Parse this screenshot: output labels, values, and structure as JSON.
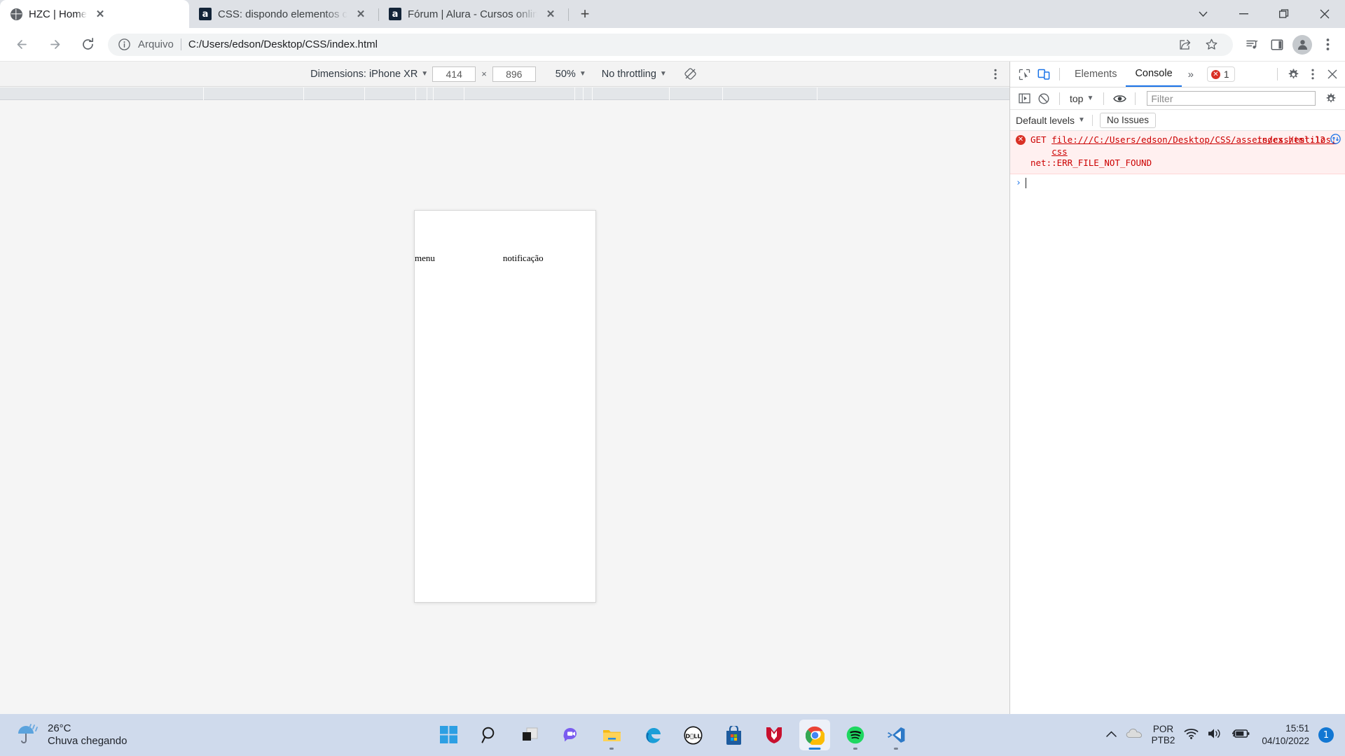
{
  "browser": {
    "tabs": [
      {
        "title": "HZC | Home",
        "favicon": "globe-icon",
        "active": true
      },
      {
        "title": "CSS: dispondo elementos com Fl",
        "favicon": "alura-icon",
        "active": false
      },
      {
        "title": "Fórum | Alura - Cursos online de",
        "favicon": "alura-icon",
        "active": false
      }
    ],
    "new_tab_label": "+",
    "close_label": "✕",
    "window_controls": [
      "tab-search-icon",
      "minimize-icon",
      "maximize-icon",
      "close-icon"
    ],
    "omnibox": {
      "scheme_label": "Arquivo",
      "url": "C:/Users/edson/Desktop/CSS/index.html",
      "info_icon": "info-circle-icon"
    },
    "toolbar_icons": [
      "back-icon",
      "forward-icon",
      "reload-icon",
      "share-icon",
      "bookmark-star-icon",
      "media-list-icon",
      "side-panel-icon",
      "profile-avatar-icon",
      "chrome-menu-icon"
    ]
  },
  "device_toolbar": {
    "dimensions_label": "Dimensions: iPhone XR",
    "width": "414",
    "height": "896",
    "multiply": "×",
    "zoom": "50%",
    "throttling": "No throttling",
    "rotate_icon": "rotate-device-icon",
    "kebab_icon": "more-options-icon"
  },
  "page": {
    "words": [
      "menu",
      "notificação"
    ]
  },
  "devtools": {
    "tabs": [
      {
        "label": "Elements",
        "active": false
      },
      {
        "label": "Console",
        "active": true
      }
    ],
    "more_label": "»",
    "error_count": "1",
    "error_dot_glyph": "✕",
    "left_icons": [
      "inspect-element-icon",
      "device-toggle-icon"
    ],
    "right_icons": [
      "settings-gear-icon",
      "devtools-menu-icon",
      "close-devtools-icon"
    ],
    "console_toolbar": {
      "sidebar_icon": "console-sidebar-icon",
      "clear_icon": "clear-console-icon",
      "context": "top",
      "eye_icon": "live-expression-icon",
      "filter_placeholder": "Filter",
      "settings_icon": "console-settings-icon"
    },
    "levels_bar": {
      "levels": "Default levels",
      "issues": "No Issues"
    },
    "message": {
      "method": "GET",
      "url": "file:///C:/Users/edson/Desktop/CSS/assets/css/estilos.css",
      "status": "net::ERR_FILE_NOT_FOUND",
      "source": "index.html:12",
      "open_icon": "open-in-network-panel-icon"
    },
    "prompt": {
      "caret": "›"
    }
  },
  "taskbar": {
    "weather": {
      "icon": "rain-umbrella-icon",
      "temperature": "26°C",
      "description": "Chuva chegando"
    },
    "apps": [
      {
        "name": "start-button",
        "icon": "windows-logo-icon",
        "active": false,
        "indicator": "none"
      },
      {
        "name": "search-button",
        "icon": "search-icon",
        "active": false,
        "indicator": "none"
      },
      {
        "name": "task-view-button",
        "icon": "task-view-icon",
        "active": false,
        "indicator": "none"
      },
      {
        "name": "chat-button",
        "icon": "chat-teams-icon",
        "active": false,
        "indicator": "none"
      },
      {
        "name": "file-explorer-button",
        "icon": "folder-icon",
        "active": false,
        "indicator": "dot"
      },
      {
        "name": "edge-button",
        "icon": "edge-icon",
        "active": false,
        "indicator": "none"
      },
      {
        "name": "dell-button",
        "icon": "dell-icon",
        "active": false,
        "indicator": "none"
      },
      {
        "name": "microsoft-store-button",
        "icon": "store-icon",
        "active": false,
        "indicator": "none"
      },
      {
        "name": "mcafee-button",
        "icon": "mcafee-shield-icon",
        "active": false,
        "indicator": "none"
      },
      {
        "name": "chrome-button",
        "icon": "chrome-icon",
        "active": true,
        "indicator": "wide"
      },
      {
        "name": "spotify-button",
        "icon": "spotify-icon",
        "active": false,
        "indicator": "dot"
      },
      {
        "name": "vscode-button",
        "icon": "vscode-icon",
        "active": false,
        "indicator": "dot"
      }
    ],
    "tray": {
      "chevron": "show-hidden-icons-icon",
      "cloud_icon": "onedrive-icon",
      "language_line1": "POR",
      "language_line2": "PTB2",
      "wifi_icon": "wifi-icon",
      "volume_icon": "volume-icon",
      "battery_icon": "battery-charging-icon",
      "time": "15:51",
      "date": "04/10/2022",
      "notification_count": "1"
    }
  }
}
